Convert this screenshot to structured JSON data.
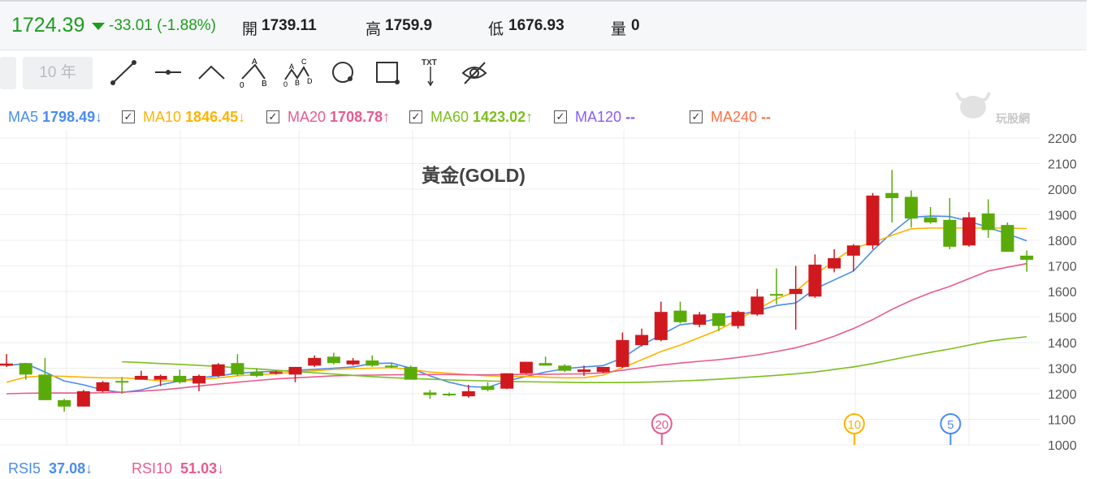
{
  "quote": {
    "price": "1724.39",
    "change": "-33.01 (-1.88%)",
    "open_label": "開",
    "open": "1739.11",
    "high_label": "高",
    "high": "1759.9",
    "low_label": "低",
    "low": "1676.93",
    "vol_label": "量",
    "vol": "0"
  },
  "toolbar": {
    "range_button": "10 年",
    "tools": [
      "line-tool",
      "horizontal-line-tool",
      "angle-tool",
      "abc-pattern-tool",
      "abcd-pattern-tool",
      "circle-tool",
      "rectangle-tool",
      "text-tool",
      "hide-drawings-tool"
    ],
    "abc_labels": [
      "A",
      "0",
      "B"
    ],
    "abcd_labels": [
      "A",
      "C",
      "0",
      "B",
      "D"
    ],
    "txt_label": "TXT"
  },
  "ma_legend": [
    {
      "name": "MA5",
      "value": "1798.49",
      "arrow": "↓",
      "color": "#4a8cf0"
    },
    {
      "name": "MA10",
      "value": "1846.45",
      "arrow": "↓",
      "color": "#ffb300"
    },
    {
      "name": "MA20",
      "value": "1708.78",
      "arrow": "↑",
      "color": "#e95b8f"
    },
    {
      "name": "MA60",
      "value": "1423.02",
      "arrow": "↑",
      "color": "#7cbf1e"
    },
    {
      "name": "MA120",
      "value": "--",
      "arrow": "",
      "color": "#8a5cf5"
    },
    {
      "name": "MA240",
      "value": "--",
      "arrow": "",
      "color": "#ff7043"
    }
  ],
  "watermark": "玩股網",
  "rsi": [
    {
      "name": "RSI5",
      "value": "37.08",
      "arrow": "↓",
      "color": "#4a8cf0"
    },
    {
      "name": "RSI10",
      "value": "51.03",
      "arrow": "↓",
      "color": "#e95b8f"
    }
  ],
  "chart_data": {
    "type": "candlestick",
    "title": "黃金(GOLD)",
    "ylim": [
      1000,
      2200
    ],
    "yticks": [
      "2200",
      "2100",
      "2000",
      "1900",
      "1800",
      "1700",
      "1600",
      "1500",
      "1400",
      "1300",
      "1200",
      "1100",
      "1000"
    ],
    "up_color": "#d0191f",
    "down_color": "#5aab0a",
    "ohlc": [
      [
        1310,
        1355,
        1305,
        1318
      ],
      [
        1320,
        1320,
        1255,
        1275
      ],
      [
        1275,
        1340,
        1175,
        1175
      ],
      [
        1175,
        1180,
        1130,
        1150
      ],
      [
        1150,
        1215,
        1150,
        1210
      ],
      [
        1210,
        1250,
        1205,
        1245
      ],
      [
        1250,
        1265,
        1200,
        1248
      ],
      [
        1255,
        1290,
        1255,
        1270
      ],
      [
        1255,
        1275,
        1230,
        1270
      ],
      [
        1270,
        1295,
        1240,
        1245
      ],
      [
        1240,
        1275,
        1210,
        1270
      ],
      [
        1270,
        1320,
        1265,
        1315
      ],
      [
        1320,
        1355,
        1270,
        1275
      ],
      [
        1285,
        1300,
        1265,
        1270
      ],
      [
        1280,
        1290,
        1275,
        1285
      ],
      [
        1275,
        1305,
        1245,
        1305
      ],
      [
        1310,
        1350,
        1305,
        1340
      ],
      [
        1345,
        1360,
        1315,
        1320
      ],
      [
        1315,
        1340,
        1310,
        1330
      ],
      [
        1330,
        1350,
        1305,
        1310
      ],
      [
        1310,
        1320,
        1300,
        1308
      ],
      [
        1305,
        1310,
        1255,
        1255
      ],
      [
        1205,
        1215,
        1180,
        1195
      ],
      [
        1200,
        1205,
        1190,
        1195
      ],
      [
        1190,
        1235,
        1185,
        1210
      ],
      [
        1230,
        1245,
        1210,
        1215
      ],
      [
        1220,
        1280,
        1218,
        1280
      ],
      [
        1280,
        1325,
        1278,
        1325
      ],
      [
        1320,
        1345,
        1310,
        1310
      ],
      [
        1310,
        1315,
        1285,
        1290
      ],
      [
        1285,
        1310,
        1270,
        1295
      ],
      [
        1285,
        1305,
        1280,
        1305
      ],
      [
        1305,
        1440,
        1300,
        1410
      ],
      [
        1390,
        1455,
        1385,
        1430
      ],
      [
        1410,
        1560,
        1405,
        1520
      ],
      [
        1525,
        1560,
        1475,
        1480
      ],
      [
        1470,
        1520,
        1460,
        1510
      ],
      [
        1515,
        1515,
        1445,
        1465
      ],
      [
        1465,
        1525,
        1455,
        1520
      ],
      [
        1510,
        1610,
        1505,
        1580
      ],
      [
        1590,
        1690,
        1550,
        1585
      ],
      [
        1590,
        1700,
        1450,
        1610
      ],
      [
        1580,
        1745,
        1575,
        1705
      ],
      [
        1690,
        1765,
        1675,
        1730
      ],
      [
        1740,
        1785,
        1680,
        1780
      ],
      [
        1780,
        1985,
        1765,
        1975
      ],
      [
        1985,
        2075,
        1870,
        1965
      ],
      [
        1970,
        1995,
        1850,
        1885
      ],
      [
        1890,
        1930,
        1865,
        1870
      ],
      [
        1880,
        1965,
        1765,
        1775
      ],
      [
        1780,
        1910,
        1775,
        1890
      ],
      [
        1905,
        1960,
        1810,
        1840
      ],
      [
        1860,
        1870,
        1755,
        1755
      ],
      [
        1740,
        1760,
        1677,
        1724
      ]
    ],
    "series": [
      {
        "name": "MA5",
        "color": "#4a8cf0",
        "values": [
          1310,
          1318,
          1285,
          1250,
          1235,
          1215,
          1205,
          1215,
          1235,
          1250,
          1262,
          1270,
          1280,
          1285,
          1288,
          1292,
          1295,
          1300,
          1305,
          1318,
          1320,
          1300,
          1270,
          1245,
          1228,
          1225,
          1250,
          1268,
          1285,
          1298,
          1305,
          1310,
          1340,
          1390,
          1430,
          1470,
          1478,
          1495,
          1508,
          1525,
          1545,
          1555,
          1610,
          1645,
          1680,
          1760,
          1830,
          1890,
          1895,
          1893,
          1875,
          1850,
          1825,
          1798
        ]
      },
      {
        "name": "MA10",
        "color": "#ffb300",
        "values": [
          1245,
          1265,
          1270,
          1268,
          1265,
          1262,
          1262,
          1258,
          1250,
          1250,
          1255,
          1262,
          1270,
          1275,
          1278,
          1285,
          1290,
          1295,
          1298,
          1300,
          1302,
          1295,
          1285,
          1280,
          1275,
          1270,
          1268,
          1268,
          1265,
          1262,
          1263,
          1273,
          1302,
          1333,
          1365,
          1390,
          1420,
          1450,
          1490,
          1530,
          1571,
          1600,
          1665,
          1720,
          1770,
          1790,
          1820,
          1845,
          1848,
          1848,
          1848,
          1848,
          1848,
          1846
        ]
      },
      {
        "name": "MA20",
        "color": "#e95b8f",
        "values": [
          1200,
          1202,
          1203,
          1203,
          1203,
          1204,
          1206,
          1210,
          1215,
          1222,
          1230,
          1238,
          1245,
          1252,
          1258,
          1262,
          1266,
          1270,
          1272,
          1273,
          1274,
          1275,
          1275,
          1275,
          1274,
          1274,
          1275,
          1276,
          1276,
          1277,
          1278,
          1282,
          1292,
          1302,
          1312,
          1320,
          1327,
          1333,
          1342,
          1352,
          1365,
          1380,
          1400,
          1425,
          1455,
          1490,
          1530,
          1565,
          1595,
          1620,
          1650,
          1680,
          1695,
          1709
        ]
      },
      {
        "name": "MA60",
        "color": "#7cbf1e",
        "values": [
          null,
          null,
          null,
          null,
          null,
          null,
          1325,
          1322,
          1318,
          1315,
          1311,
          1307,
          1302,
          1297,
          1292,
          1287,
          1282,
          1277,
          1272,
          1267,
          1263,
          1260,
          1257,
          1254,
          1252,
          1250,
          1248,
          1247,
          1246,
          1245,
          1244,
          1244,
          1244,
          1245,
          1247,
          1250,
          1253,
          1257,
          1262,
          1267,
          1272,
          1278,
          1285,
          1295,
          1305,
          1318,
          1333,
          1348,
          1362,
          1375,
          1390,
          1405,
          1415,
          1423
        ]
      }
    ],
    "markers": [
      {
        "label": "20",
        "index": 34,
        "color": "#e95b8f"
      },
      {
        "label": "10",
        "index": 44,
        "color": "#ffb300"
      },
      {
        "label": "5",
        "index": 49,
        "color": "#4a8cf0"
      }
    ]
  }
}
